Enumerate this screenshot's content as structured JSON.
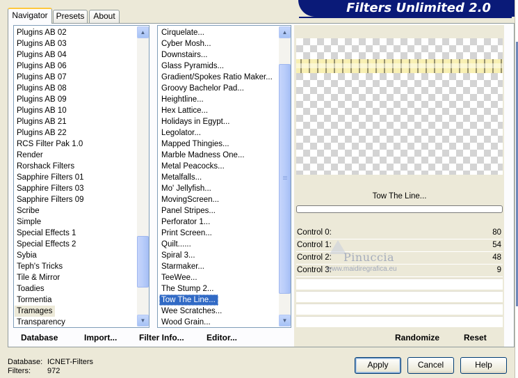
{
  "tabs": [
    {
      "label": "Navigator",
      "active": true
    },
    {
      "label": "Presets",
      "active": false
    },
    {
      "label": "About",
      "active": false
    }
  ],
  "banner": {
    "title": "Filters Unlimited 2.0",
    "color": "#0a1a78"
  },
  "categories": {
    "items": [
      "Plugins AB 02",
      "Plugins AB 03",
      "Plugins AB 04",
      "Plugins AB 06",
      "Plugins AB 07",
      "Plugins AB 08",
      "Plugins AB 09",
      "Plugins AB 10",
      "Plugins AB 21",
      "Plugins AB 22",
      "RCS Filter Pak 1.0",
      "Render",
      "Rorshack Filters",
      "Sapphire Filters 01",
      "Sapphire Filters 03",
      "Sapphire Filters 09",
      "Scribe",
      "Simple",
      "Special Effects 1",
      "Special Effects 2",
      "Sybia",
      "Teph's Tricks",
      "Tile & Mirror",
      "Toadies",
      "Tormentia",
      "Tramages",
      "Transparency"
    ],
    "selected_index": 25,
    "scroll_position": 0.88
  },
  "filters": {
    "items": [
      "Cirquelate...",
      "Cyber Mosh...",
      "Downstairs...",
      "Glass Pyramids...",
      "Gradient/Spokes Ratio Maker...",
      "Groovy Bachelor Pad...",
      "Heightline...",
      "Hex Lattice...",
      "Holidays in Egypt...",
      "Legolator...",
      "Mapped Thingies...",
      "Marble Madness One...",
      "Metal Peacocks...",
      "Metalfalls...",
      "Mo' Jellyfish...",
      "MovingScreen...",
      "Panel Stripes...",
      "Perforator 1...",
      "Print Screen...",
      "Quilt......",
      "Spiral 3...",
      "Starmaker...",
      "TeeWee...",
      "The Stump 2...",
      "Tow The Line...",
      "Wee Scratches...",
      "Wood Grain..."
    ],
    "selected_index": 24,
    "scroll_position": 0.55
  },
  "preview": {
    "filter_name": "Tow The Line...",
    "progress": 0
  },
  "controls": [
    {
      "label": "Control 0:",
      "value": "80"
    },
    {
      "label": "Control 1:",
      "value": "54"
    },
    {
      "label": "Control 2:",
      "value": "48"
    },
    {
      "label": "Control 3:",
      "value": "9"
    }
  ],
  "watermark": {
    "name": "Pinuccia",
    "url": "www.maidiregrafica.eu"
  },
  "bottom_links": {
    "database": "Database",
    "import": "Import...",
    "filter_info": "Filter Info...",
    "editor": "Editor...",
    "randomize": "Randomize",
    "reset": "Reset"
  },
  "status": {
    "database_label": "Database:",
    "database_value": "ICNET-Filters",
    "filters_label": "Filters:",
    "filters_value": "972"
  },
  "buttons": {
    "apply": "Apply",
    "cancel": "Cancel",
    "help": "Help"
  },
  "icons": {
    "scroll_up": "scroll-up-arrow-icon",
    "scroll_down": "scroll-down-arrow-icon",
    "grip": "scroll-grip-icon"
  }
}
